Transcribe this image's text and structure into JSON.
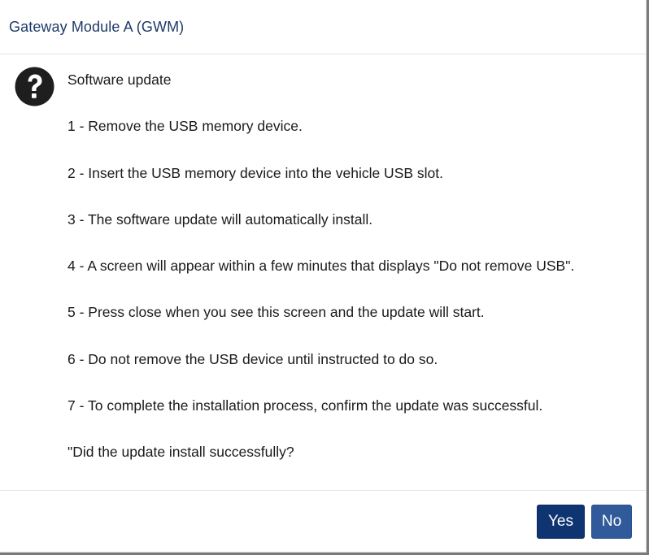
{
  "dialog": {
    "title": "Gateway Module A (GWM)",
    "icon": "question-circle-icon",
    "lines": [
      "Software update",
      "1 - Remove the USB memory device.",
      "2 - Insert the USB memory device into the vehicle USB slot.",
      "3 - The software update will automatically install.",
      "4 - A screen will appear within a few minutes that displays \"Do not remove USB\".",
      "5 - Press close when you see this screen and the update will start.",
      "6 - Do not remove the USB device until instructed to do so.",
      "7 - To complete the installation process, confirm the update was successful.",
      "\"Did the update install successfully?"
    ],
    "buttons": {
      "yes_label": "Yes",
      "no_label": "No"
    }
  },
  "colors": {
    "title": "#1f3a68",
    "yes_button": "#0f3472",
    "no_button": "#305a99",
    "icon": "#1e1e1e"
  }
}
